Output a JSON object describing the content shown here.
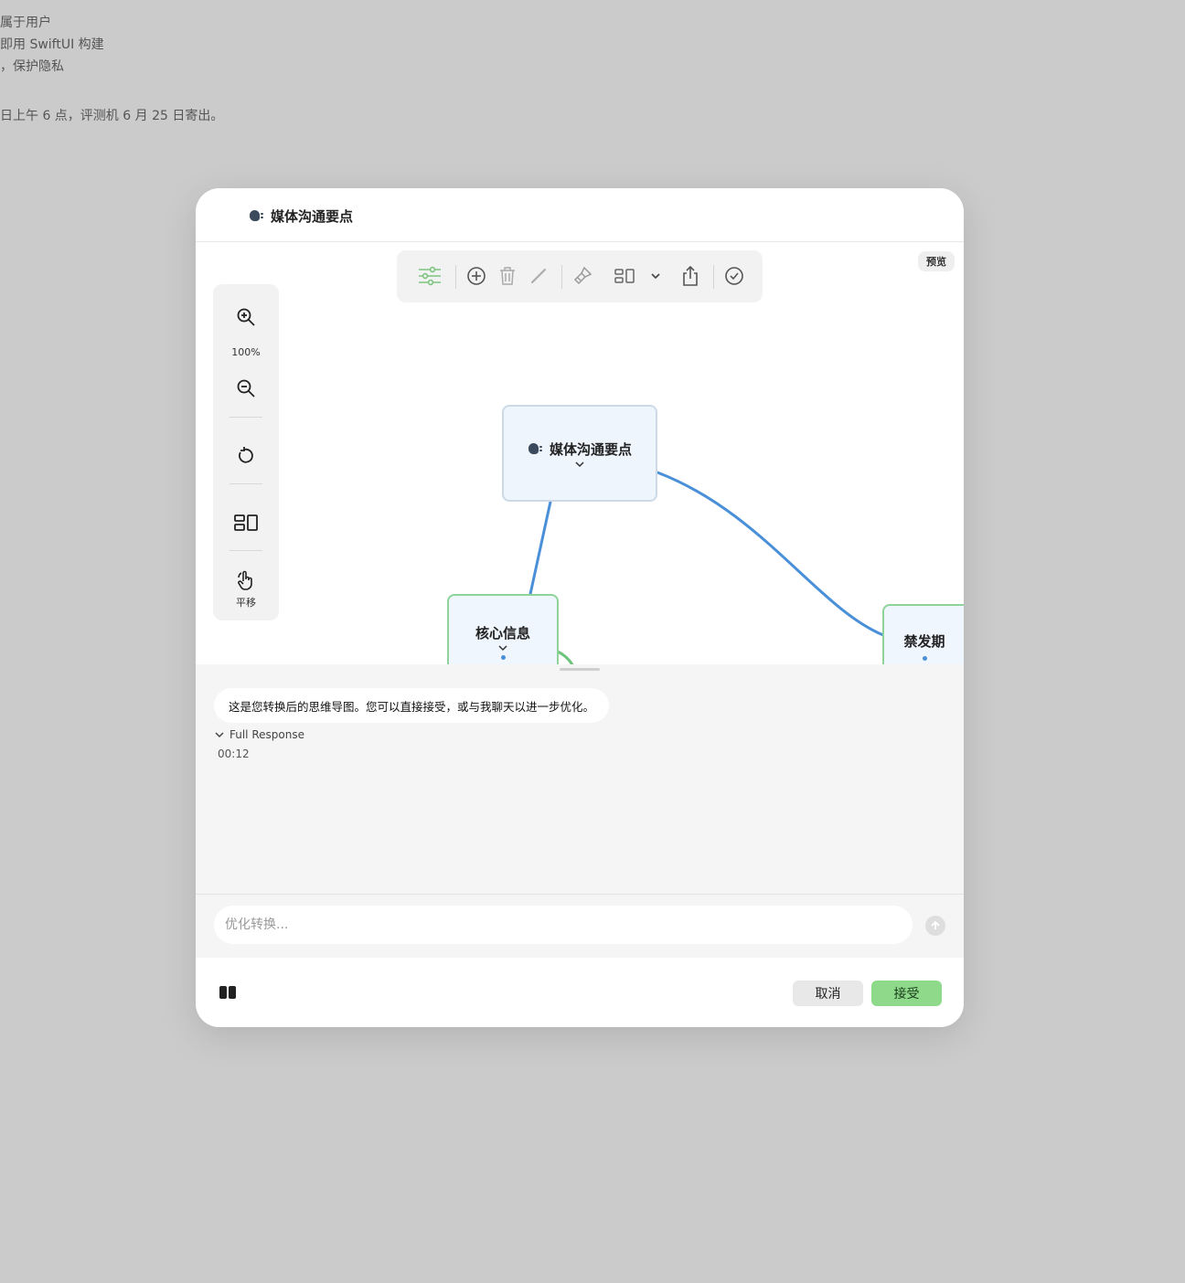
{
  "background_text": {
    "line1": "属于用户",
    "line2": "即用 SwiftUI 构建",
    "line3": "，保护隐私",
    "line4": "日上午 6 点，评测机 6 月 25 日寄出。"
  },
  "dialog": {
    "title": "媒体沟通要点",
    "preview_label": "预览"
  },
  "toolbar": {
    "icons": [
      "settings-sliders-icon",
      "add-circle-icon",
      "trash-icon",
      "pencil-icon",
      "brush-icon",
      "layout-icon",
      "chevron-down-icon",
      "share-icon",
      "checkmark-circle-icon"
    ]
  },
  "side_panel": {
    "zoom_level": "100%",
    "pan_label": "平移"
  },
  "mindmap": {
    "root": "媒体沟通要点",
    "children": [
      "核心信息",
      "禁发期"
    ]
  },
  "chat": {
    "message": "这是您转换后的思维导图。您可以直接接受，或与我聊天以进一步优化。",
    "full_response_label": "Full Response",
    "elapsed": "00:12"
  },
  "input": {
    "placeholder": "优化转换..."
  },
  "footer": {
    "cancel_label": "取消",
    "accept_label": "接受"
  },
  "colors": {
    "accent_green": "#8fd98b",
    "connector_blue": "#4a90d9",
    "node_border_green": "#8ed49a"
  }
}
